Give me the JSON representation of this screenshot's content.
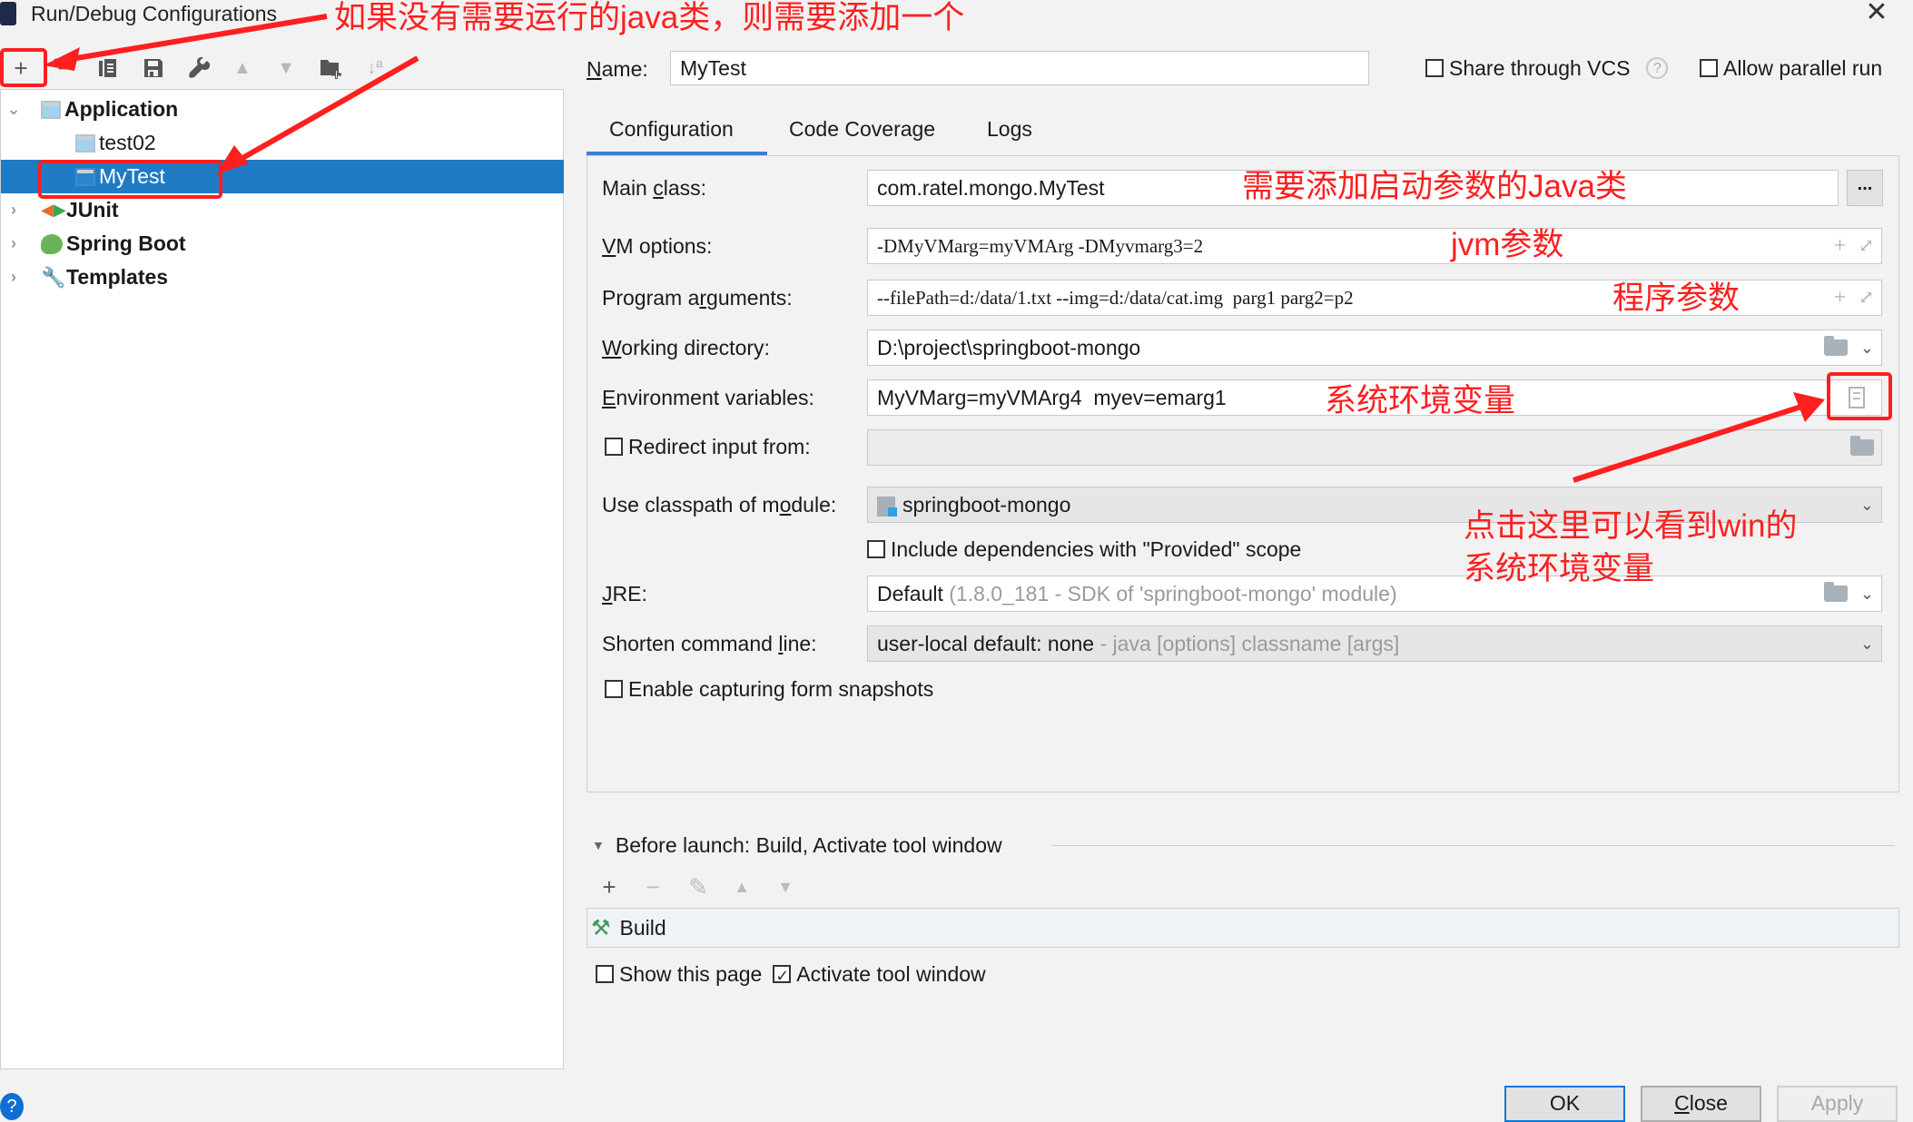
{
  "window": {
    "title": "Run/Debug Configurations",
    "close_icon": "close-icon"
  },
  "toolbar": {
    "items": [
      {
        "name": "add",
        "glyph": "+",
        "enabled": true
      },
      {
        "name": "remove",
        "glyph": "−",
        "enabled": true
      },
      {
        "name": "copy",
        "glyph": "▤",
        "enabled": true
      },
      {
        "name": "save",
        "glyph": "🖫",
        "enabled": true
      },
      {
        "name": "edit-defaults",
        "glyph": "🔧",
        "enabled": true
      },
      {
        "name": "move-up",
        "glyph": "▲",
        "enabled": false
      },
      {
        "name": "move-down",
        "glyph": "▼",
        "enabled": false
      },
      {
        "name": "new-folder",
        "glyph": "📁",
        "enabled": true
      },
      {
        "name": "sort",
        "glyph": "↓ª",
        "enabled": false
      }
    ]
  },
  "tree": {
    "items": [
      {
        "label": "Application",
        "level": 0,
        "expanded": true,
        "bold": true,
        "icon": "application-icon"
      },
      {
        "label": "test02",
        "level": 1,
        "icon": "application-icon"
      },
      {
        "label": "MyTest",
        "level": 1,
        "selected": true,
        "icon": "application-icon"
      },
      {
        "label": "JUnit",
        "level": 0,
        "expanded": false,
        "bold": true,
        "icon": "junit-icon"
      },
      {
        "label": "Spring Boot",
        "level": 0,
        "expanded": false,
        "bold": true,
        "icon": "spring-boot-icon"
      },
      {
        "label": "Templates",
        "level": 0,
        "expanded": false,
        "bold": true,
        "icon": "wrench-icon"
      }
    ]
  },
  "header": {
    "name_label": "Name:",
    "name_value": "MyTest",
    "share_vcs_label": "Share through VCS",
    "share_vcs_checked": false,
    "allow_parallel_label": "Allow parallel run",
    "allow_parallel_checked": false
  },
  "tabs": [
    {
      "label": "Configuration",
      "active": true
    },
    {
      "label": "Code Coverage",
      "active": false
    },
    {
      "label": "Logs",
      "active": false
    }
  ],
  "form": {
    "main_class": {
      "label": "Main class:",
      "value": "com.ratel.mongo.MyTest",
      "button": "..."
    },
    "vm_options": {
      "label": "VM options:",
      "value": "-DMyVMarg=myVMArg -DMyvmarg3=2"
    },
    "program_arguments": {
      "label": "Program arguments:",
      "value": "--filePath=d:/data/1.txt --img=d:/data/cat.img  parg1 parg2=p2"
    },
    "working_directory": {
      "label": "Working directory:",
      "value": "D:\\project\\springboot-mongo"
    },
    "environment_variables": {
      "label": "Environment variables:",
      "value": "MyVMarg=myVMArg4  myev=emarg1"
    },
    "redirect_input": {
      "label": "Redirect input from:",
      "checked": false,
      "value": ""
    },
    "classpath_module": {
      "label": "Use classpath of module:",
      "value": "springboot-mongo"
    },
    "include_provided": {
      "label": "Include dependencies with \"Provided\" scope",
      "checked": false
    },
    "jre": {
      "label": "JRE:",
      "value": "Default",
      "hint": "(1.8.0_181 - SDK of 'springboot-mongo' module)"
    },
    "shorten_command_line": {
      "label": "Shorten command line:",
      "value": "user-local default: none",
      "hint": "- java [options] classname [args]"
    },
    "enable_snapshots": {
      "label": "Enable capturing form snapshots",
      "checked": false
    }
  },
  "before_launch": {
    "title": "Before launch: Build, Activate tool window",
    "toolbar": [
      "+",
      "−",
      "✎",
      "▲",
      "▼"
    ],
    "items": [
      "Build"
    ],
    "show_this_page_label": "Show this page",
    "show_this_page_checked": false,
    "activate_tool_window_label": "Activate tool window",
    "activate_tool_window_checked": true
  },
  "buttons": {
    "ok": "OK",
    "close": "Close",
    "apply": "Apply",
    "help": "?"
  },
  "annotations": {
    "add_hint": "如果没有需要运行的java类，则需要添加一个",
    "main_class_hint": "需要添加启动参数的Java类",
    "vm_hint": "jvm参数",
    "program_hint": "程序参数",
    "env_hint": "系统环境变量",
    "env_button_hint_line1": "点击这里可以看到win的",
    "env_button_hint_line2": "系统环境变量",
    "color": "#ff1f1f"
  }
}
